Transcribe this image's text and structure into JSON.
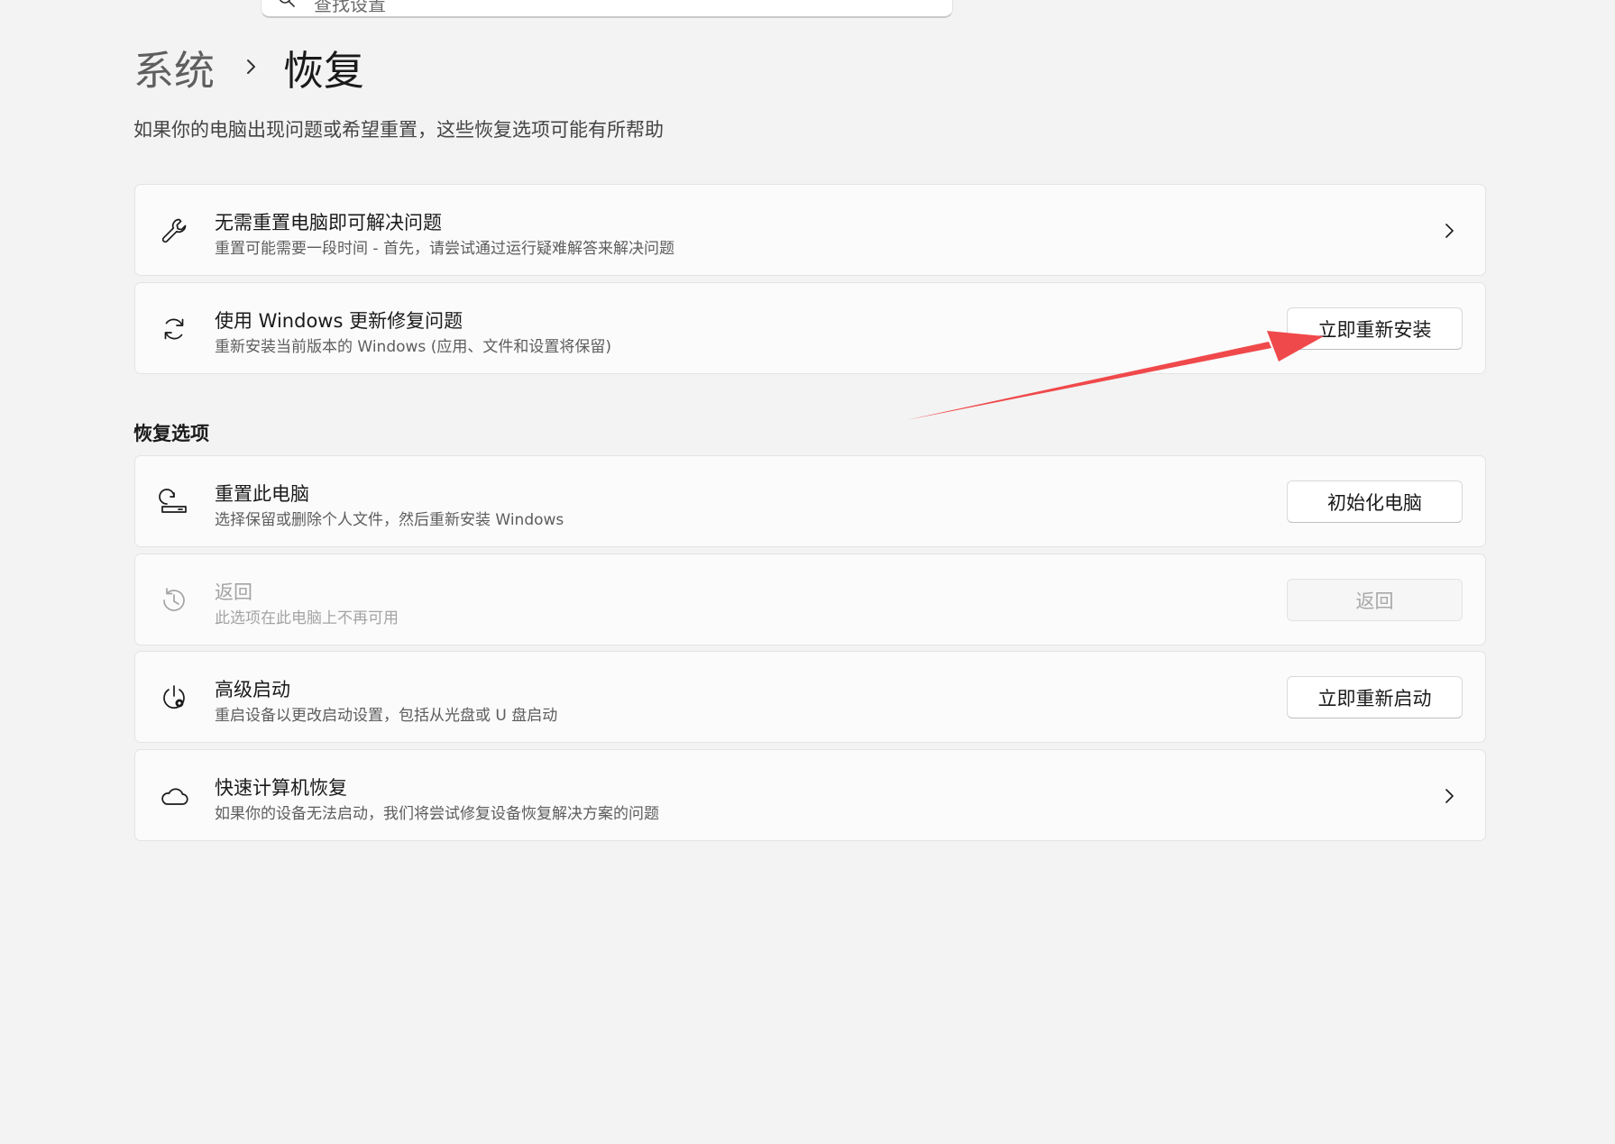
{
  "search": {
    "placeholder": "查找设置"
  },
  "breadcrumb": {
    "parent": "系统",
    "separator_icon": "chevron-right-icon",
    "current": "恢复"
  },
  "page_subtitle": "如果你的电脑出现问题或希望重置，这些恢复选项可能有所帮助",
  "cards_top": [
    {
      "icon": "wrench-icon",
      "title": "无需重置电脑即可解决问题",
      "description": "重置可能需要一段时间 - 首先，请尝试通过运行疑难解答来解决问题",
      "action": "chevron"
    },
    {
      "icon": "refresh-icon",
      "title": "使用 Windows 更新修复问题",
      "description": "重新安装当前版本的 Windows (应用、文件和设置将保留)",
      "button_label": "立即重新安装"
    }
  ],
  "recovery_options": {
    "section_title": "恢复选项",
    "items": [
      {
        "icon": "reset-pc-icon",
        "title": "重置此电脑",
        "description": "选择保留或删除个人文件，然后重新安装 Windows",
        "button_label": "初始化电脑"
      },
      {
        "icon": "history-icon",
        "title": "返回",
        "description": "此选项在此电脑上不再可用",
        "button_label": "返回",
        "disabled": true
      },
      {
        "icon": "advanced-startup-icon",
        "title": "高级启动",
        "description": "重启设备以更改启动设置，包括从光盘或 U 盘启动",
        "button_label": "立即重新启动"
      },
      {
        "icon": "cloud-icon",
        "title": "快速计算机恢复",
        "description": "如果你的设备无法启动，我们将尝试修复设备恢复解决方案的问题",
        "action": "chevron"
      }
    ]
  },
  "annotation": {
    "color": "#f0494b",
    "icon": "arrow-annotation"
  },
  "colors": {
    "background": "#f3f3f3",
    "card": "#fbfbfb",
    "card_border": "#e3e3e3"
  }
}
